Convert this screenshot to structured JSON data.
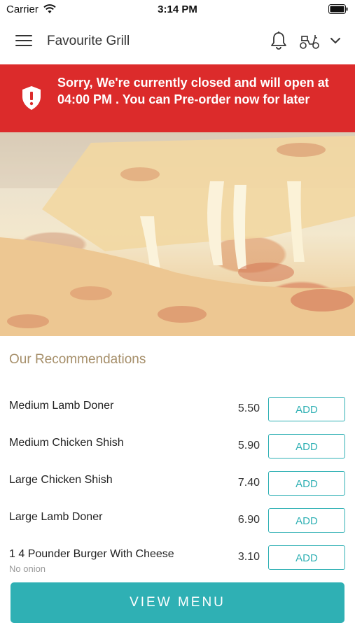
{
  "status_bar": {
    "carrier": "Carrier",
    "time": "3:14 PM"
  },
  "header": {
    "title": "Favourite Grill",
    "icons": [
      "hamburger-menu-icon",
      "bell-icon",
      "scooter-icon",
      "chevron-down-icon"
    ]
  },
  "banner": {
    "message": "Sorry, We're currently closed and will open at 04:00 PM . You can Pre-order now for later",
    "icon": "shield-alert-icon",
    "color": "#dc2b2b"
  },
  "recommendations": {
    "title": "Our Recommendations",
    "add_label": "ADD",
    "items": [
      {
        "name": "Medium Lamb Doner",
        "price": "5.50",
        "note": ""
      },
      {
        "name": "Medium Chicken Shish",
        "price": "5.90",
        "note": ""
      },
      {
        "name": "Large Chicken Shish",
        "price": "7.40",
        "note": ""
      },
      {
        "name": "Large Lamb Doner",
        "price": "6.90",
        "note": ""
      },
      {
        "name": "1 4 Pounder Burger With Cheese",
        "price": "3.10",
        "note": "No onion"
      }
    ]
  },
  "footer": {
    "view_menu_label": "VIEW MENU",
    "accent_color": "#2fb0b4"
  }
}
